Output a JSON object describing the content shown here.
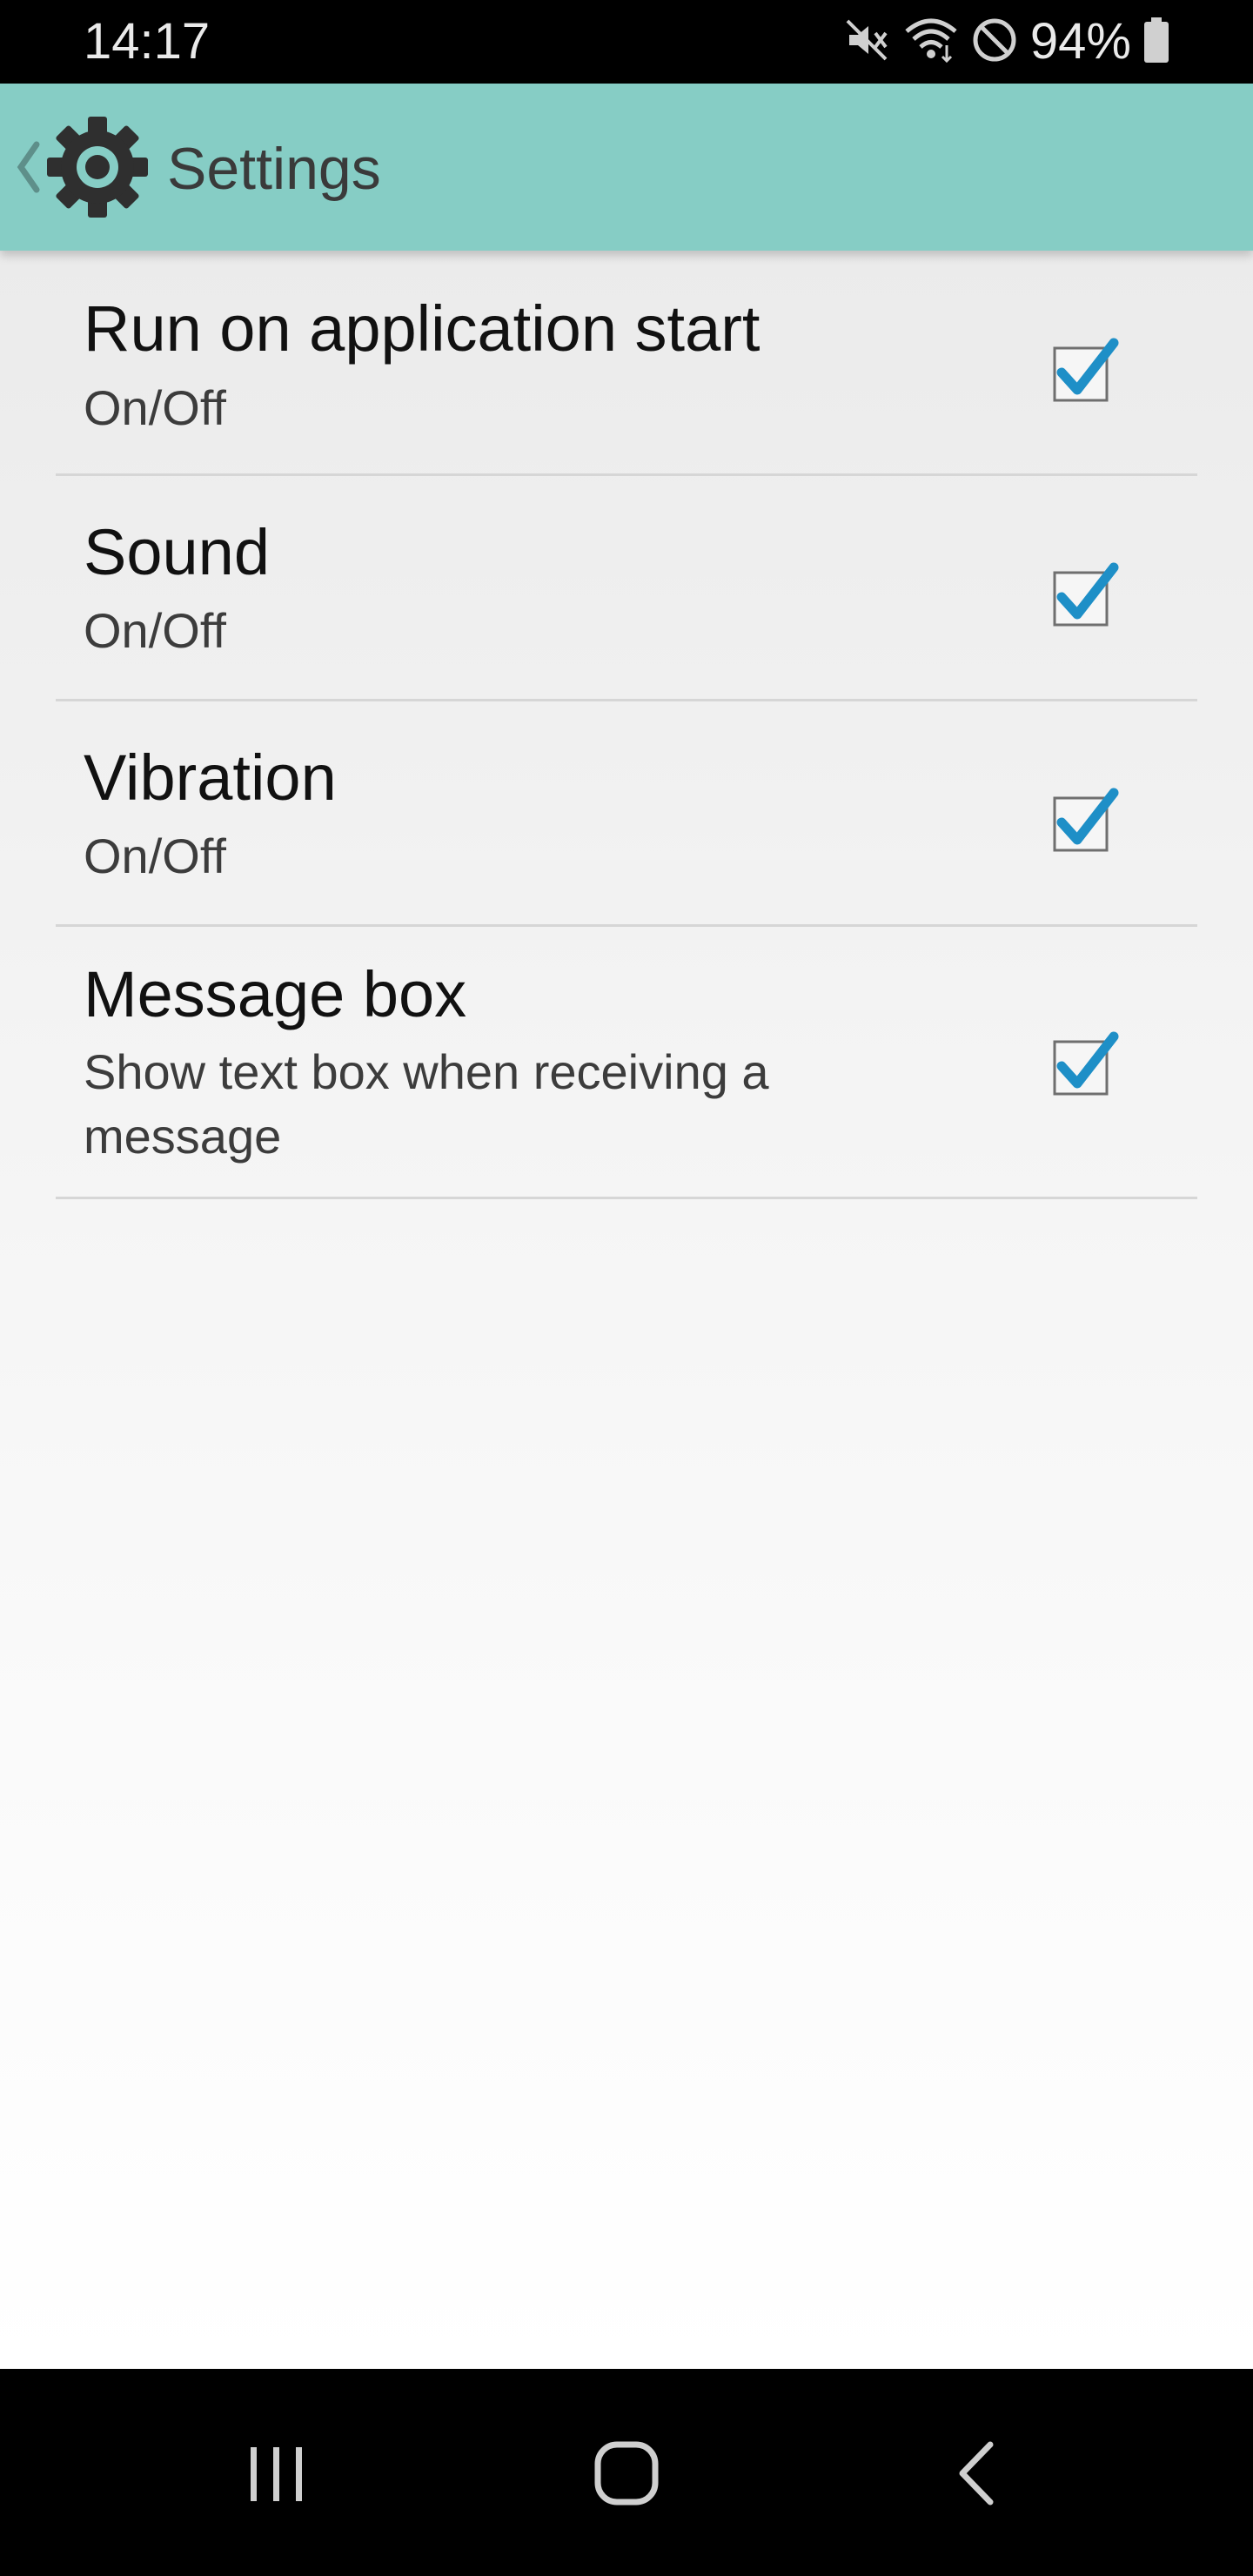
{
  "status_bar": {
    "time": "14:17",
    "battery_text": "94%",
    "icons": [
      "mute-icon",
      "wifi-icon",
      "do-not-disturb-icon",
      "battery-icon"
    ]
  },
  "action_bar": {
    "title": "Settings",
    "icons": [
      "chevron-left-icon",
      "gear-icon"
    ],
    "background_color": "#86cdc5"
  },
  "preferences": [
    {
      "title": "Run on application start",
      "summary": "On/Off",
      "checked": true
    },
    {
      "title": "Sound",
      "summary": "On/Off",
      "checked": true
    },
    {
      "title": "Vibration",
      "summary": "On/Off",
      "checked": true
    },
    {
      "title": "Message box",
      "summary": "Show text box when receiving a message",
      "checked": true
    }
  ],
  "nav_bar": {
    "buttons": [
      "recent-apps-icon",
      "home-icon",
      "back-icon"
    ]
  },
  "colors": {
    "accent_check": "#1e8fc7"
  }
}
